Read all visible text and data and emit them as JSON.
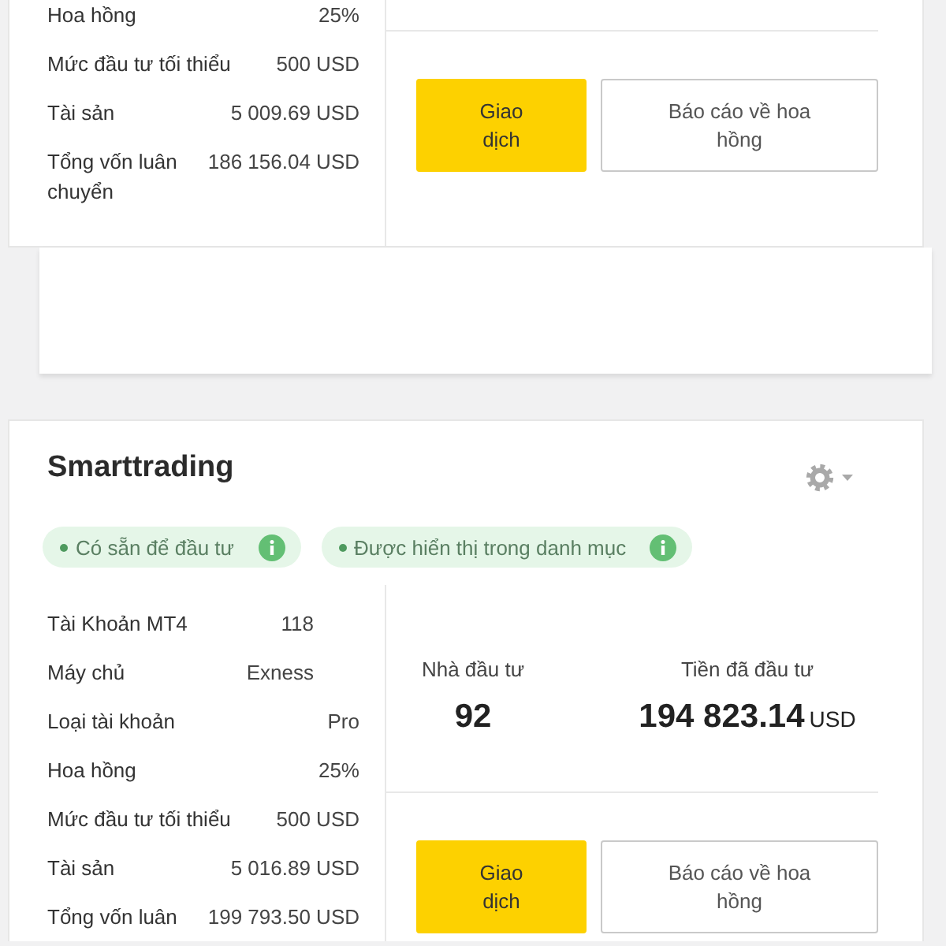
{
  "cards": [
    {
      "details": [
        {
          "label": "Hoa hồng",
          "value": "25%"
        },
        {
          "label": "Mức đầu tư tối thiểu",
          "value": "500 USD"
        },
        {
          "label": "Tài sản",
          "value": "5 009.69 USD"
        },
        {
          "label": "Tổng vốn luân chuyển",
          "value": "186 156.04 USD"
        }
      ],
      "buttons": [
        {
          "label": "Giao dịch",
          "kind": "primary"
        },
        {
          "label": "Báo cáo về hoa hồng",
          "kind": "secondary"
        }
      ]
    },
    {
      "title": "Smarttrading",
      "badges": [
        {
          "label": "Có sẵn để đầu tư"
        },
        {
          "label": "Được hiển thị trong danh mục"
        }
      ],
      "details": [
        {
          "label": "Tài Khoản MT4",
          "value": "118"
        },
        {
          "label": "Máy chủ",
          "value": "Exness"
        },
        {
          "label": "Loại tài khoản",
          "value": "Pro"
        },
        {
          "label": "Hoa hồng",
          "value": "25%"
        },
        {
          "label": "Mức đầu tư tối thiểu",
          "value": "500 USD"
        },
        {
          "label": "Tài sản",
          "value": "5 016.89 USD"
        },
        {
          "label": "Tổng vốn luân",
          "value": "199 793.50 USD"
        }
      ],
      "stats": [
        {
          "label": "Nhà đầu tư",
          "value": "92"
        },
        {
          "label": "Tiền đã đầu tư",
          "value": "194 823.14",
          "unit": "USD"
        }
      ],
      "buttons": [
        {
          "label": "Giao dịch",
          "kind": "primary"
        },
        {
          "label": "Báo cáo về hoa hồng",
          "kind": "secondary"
        }
      ]
    }
  ]
}
